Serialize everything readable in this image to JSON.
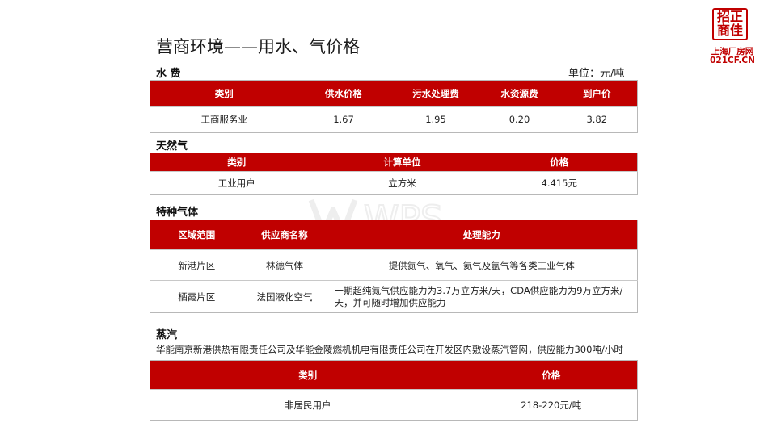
{
  "title": "营商环境——用水、气价格",
  "logo": {
    "seal_text": "招正商佳",
    "site_name": "上海厂房网",
    "url": "021CF.CN"
  },
  "watermark": "WPS",
  "water": {
    "heading": "水  费",
    "unit": "单位：元/吨",
    "headers": [
      "类别",
      "供水价格",
      "污水处理费",
      "水资源费",
      "到户价"
    ],
    "rows": [
      [
        "工商服务业",
        "1.67",
        "1.95",
        "0.20",
        "3.82"
      ]
    ]
  },
  "gas": {
    "heading": "天然气",
    "headers": [
      "类别",
      "计算单位",
      "价格"
    ],
    "rows": [
      [
        "工业用户",
        "立方米",
        "4.415元"
      ]
    ]
  },
  "special_gas": {
    "heading": "特种气体",
    "headers": [
      "区域范围",
      "供应商名称",
      "处理能力"
    ],
    "rows": [
      [
        "新港片区",
        "林德气体",
        "提供氮气、氧气、氦气及氩气等各类工业气体"
      ],
      [
        "栖霞片区",
        "法国液化空气",
        "一期超纯氮气供应能力为3.7万立方米/天，CDA供应能力为9万立方米/天，并可随时增加供应能力"
      ]
    ]
  },
  "steam": {
    "heading": "蒸汽",
    "description": "华能南京新港供热有限责任公司及华能金陵燃机机电有限责任公司在开发区内敷设蒸汽管网，供应能力300吨/小时",
    "headers": [
      "类别",
      "价格"
    ],
    "rows": [
      [
        "非居民用户",
        "218-220元/吨"
      ]
    ]
  },
  "colors": {
    "accent": "#c00000",
    "header_text": "#ffffff"
  }
}
